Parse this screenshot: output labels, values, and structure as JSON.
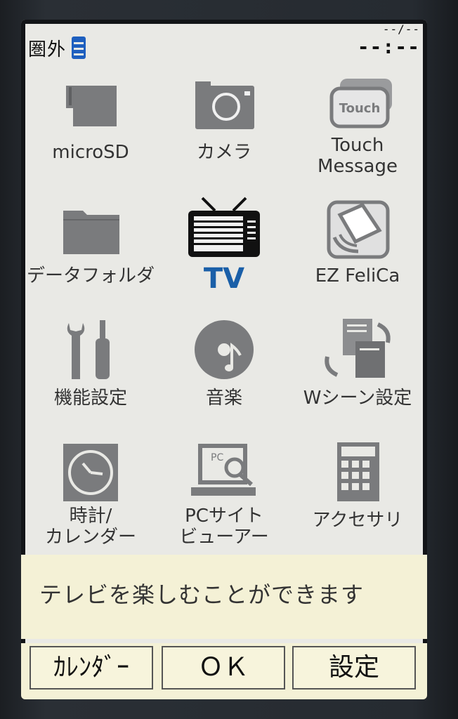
{
  "status": {
    "carrier": "圏外",
    "date": "--/--",
    "time": "--:--"
  },
  "menu": {
    "items": [
      {
        "label": "microSD",
        "icon": "microsd-card-icon"
      },
      {
        "label": "カメラ",
        "icon": "camera-icon"
      },
      {
        "label": "Touch\nMessage",
        "icon": "touch-message-icon"
      },
      {
        "label": "データフォルダ",
        "icon": "folder-icon"
      },
      {
        "label": "TV",
        "icon": "tv-icon",
        "selected": true
      },
      {
        "label": "EZ FeliCa",
        "icon": "felica-icon"
      },
      {
        "label": "機能設定",
        "icon": "tools-icon"
      },
      {
        "label": "音楽",
        "icon": "music-disc-icon"
      },
      {
        "label": "Wシーン設定",
        "icon": "w-scene-icon"
      },
      {
        "label": "時計/\nカレンダー",
        "icon": "clock-icon"
      },
      {
        "label": "PCサイト\nビューアー",
        "icon": "pc-site-viewer-icon"
      },
      {
        "label": "アクセサリ",
        "icon": "calculator-icon"
      }
    ]
  },
  "help": {
    "text": "テレビを楽しむことができます"
  },
  "softkeys": {
    "left": "ｶﾚﾝﾀﾞｰ",
    "center": "ＯＫ",
    "right": "設定"
  },
  "colors": {
    "selected": "#1a5fa8",
    "icon_gray": "#7a7b7d",
    "help_bg": "#f4f1d6"
  }
}
